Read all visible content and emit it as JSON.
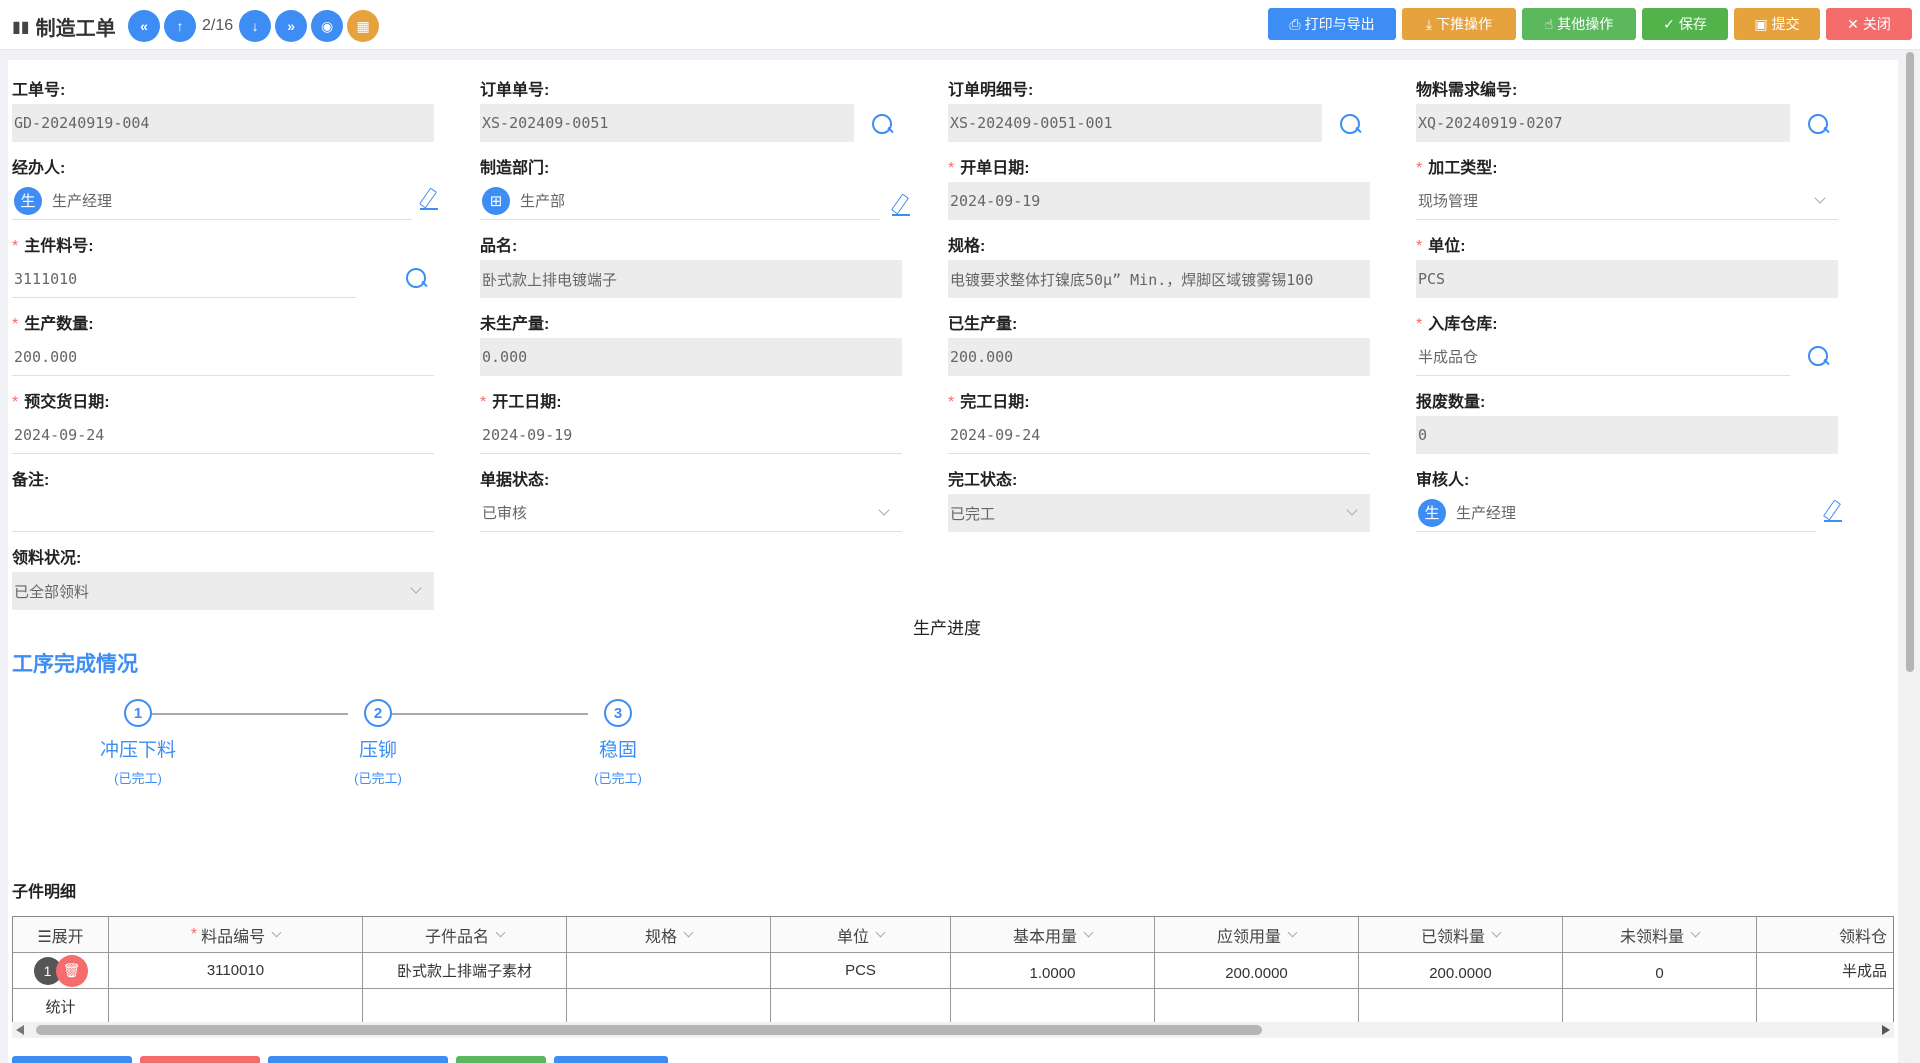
{
  "header": {
    "title": "制造工单",
    "pager": "2/16",
    "actions": {
      "print": "打印与导出",
      "push": "下推操作",
      "other": "其他操作",
      "save": "保存",
      "submit": "提交",
      "close": "关闭"
    }
  },
  "form": {
    "work_order_no": {
      "label": "工单号:",
      "value": "GD-20240919-004"
    },
    "sales_order_no": {
      "label": "订单单号:",
      "value": "XS-202409-0051"
    },
    "order_detail_no": {
      "label": "订单明细号:",
      "value": "XS-202409-0051-001"
    },
    "material_req_no": {
      "label": "物料需求编号:",
      "value": "XQ-20240919-0207"
    },
    "handler": {
      "label": "经办人:",
      "value": "生产经理",
      "avatar": "生"
    },
    "dept": {
      "label": "制造部门:",
      "value": "生产部"
    },
    "open_date": {
      "label": "开单日期:",
      "value": "2024-09-19"
    },
    "process_type": {
      "label": "加工类型:",
      "value": "现场管理"
    },
    "main_part_no": {
      "label": "主件料号:",
      "value": "3111010"
    },
    "product_name": {
      "label": "品名:",
      "value": "卧式款上排电镀端子"
    },
    "spec": {
      "label": "规格:",
      "value": "电镀要求整体打镍底50μ” Min.，焊脚区域镀雾锡100"
    },
    "unit": {
      "label": "单位:",
      "value": "PCS"
    },
    "prod_qty": {
      "label": "生产数量:",
      "value": "200.000"
    },
    "unproduced_qty": {
      "label": "未生产量:",
      "value": "0.000"
    },
    "produced_qty": {
      "label": "已生产量:",
      "value": "200.000"
    },
    "warehouse": {
      "label": "入库仓库:",
      "value": "半成品仓"
    },
    "delivery_date": {
      "label": "预交货日期:",
      "value": "2024-09-24"
    },
    "start_date": {
      "label": "开工日期:",
      "value": "2024-09-19"
    },
    "finish_date": {
      "label": "完工日期:",
      "value": "2024-09-24"
    },
    "scrap_qty": {
      "label": "报废数量:",
      "value": "0"
    },
    "remark": {
      "label": "备注:",
      "value": ""
    },
    "doc_status": {
      "label": "单据状态:",
      "value": "已审核"
    },
    "complete_status": {
      "label": "完工状态:",
      "value": "已完工"
    },
    "reviewer": {
      "label": "审核人:",
      "value": "生产经理",
      "avatar": "生"
    },
    "picking_status": {
      "label": "领料状况:",
      "value": "已全部领料"
    }
  },
  "progress": {
    "heading": "生产进度",
    "section_title": "工序完成情况",
    "steps": [
      {
        "num": "1",
        "name": "冲压下料",
        "status": "(已完工)"
      },
      {
        "num": "2",
        "name": "压铆",
        "status": "(已完工)"
      },
      {
        "num": "3",
        "name": "稳固",
        "status": "(已完工)"
      }
    ]
  },
  "subparts": {
    "title": "子件明细",
    "columns": [
      "☰展开",
      "料品编号",
      "子件品名",
      "规格",
      "单位",
      "基本用量",
      "应领用量",
      "已领料量",
      "未领料量",
      "领料仓"
    ],
    "rows": [
      {
        "index": "1",
        "part_no": "3110010",
        "name": "卧式款上排端子素材",
        "spec": "",
        "unit": "PCS",
        "base_qty": "1.0000",
        "req_qty": "200.0000",
        "picked_qty": "200.0000",
        "unpicked_qty": "0",
        "warehouse": "半成品"
      }
    ],
    "total_label": "统计"
  }
}
